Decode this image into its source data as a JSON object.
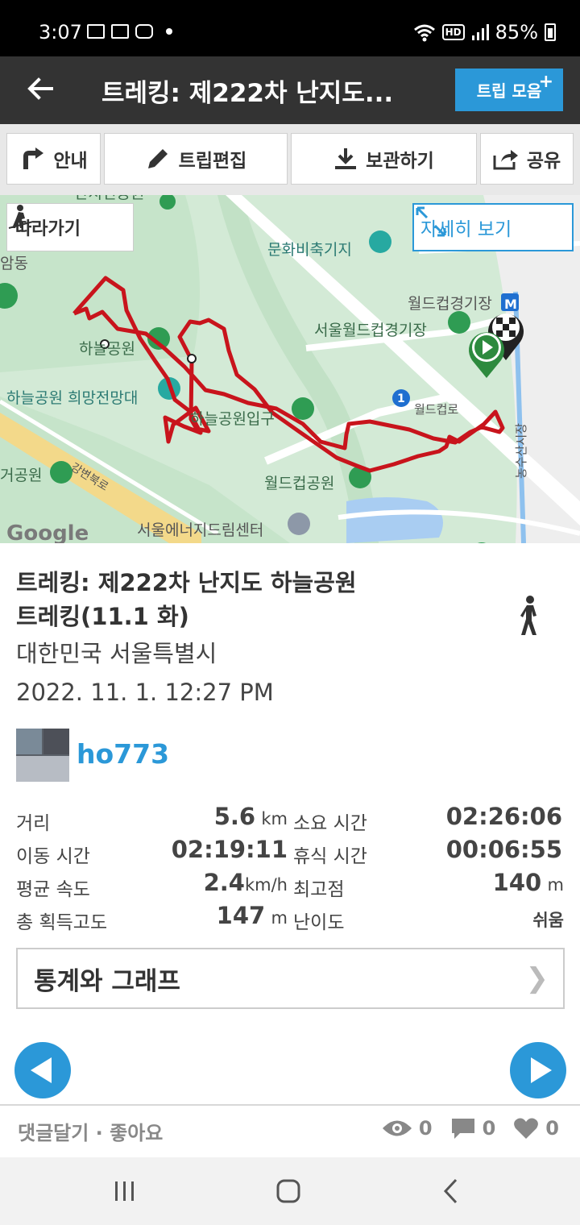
{
  "status_bar": {
    "time": "3:07",
    "battery": "85%"
  },
  "app_bar": {
    "title": "트레킹: 제222차 난지도...",
    "trip_button": "트립 모음"
  },
  "toolbar": {
    "guide": "안내",
    "edit_trip": "트립편집",
    "save": "보관하기",
    "share": "공유"
  },
  "map": {
    "follow": "따라가기",
    "view_detail": "자세히 보기",
    "labels": {
      "culture_base": "문화비축기지",
      "sky_park": "하늘공원",
      "sky_park_view": "하늘공원 희망전망대",
      "sky_park_entrance": "하늘공원입구",
      "world_cup_stadium": "월드컵경기장",
      "seoul_world_cup_stadium": "서울월드컵경기장",
      "world_cup_park": "월드컵공원",
      "world_cup_road": "월드컵로",
      "gangbyeon": "강변북로",
      "energy_dream_center": "서울에너지드림센터",
      "park_left": "거공원",
      "dong": "암동",
      "market": "농수산시장",
      "top_label": "난지연공원",
      "marker_m": "M",
      "route_no": "1",
      "google": "Google"
    }
  },
  "trip": {
    "title_line1": "트레킹: 제222차 난지도 하늘공원",
    "title_line2": "트레킹(11.1 화)",
    "location": "대한민국 서울특별시",
    "datetime": "2022. 11. 1. 12:27 PM",
    "user": "ho773"
  },
  "stats": {
    "distance_label": "거리",
    "distance_value": "5.6",
    "distance_unit": "km",
    "duration_label": "소요 시간",
    "duration_value": "02:26:06",
    "moving_label": "이동 시간",
    "moving_value": "02:19:11",
    "rest_label": "휴식 시간",
    "rest_value": "00:06:55",
    "avg_speed_label": "평균 속도",
    "avg_speed_value": "2.4",
    "avg_speed_unit": "km/h",
    "max_alt_label": "최고점",
    "max_alt_value": "140",
    "max_alt_unit": "m",
    "gain_label": "총 획득고도",
    "gain_value": "147",
    "gain_unit": "m",
    "difficulty_label": "난이도",
    "difficulty_value": "쉬움"
  },
  "graph_button": "통계와 그래프",
  "footer": {
    "comment_like": "댓글달기 · 좋아요",
    "views": "0",
    "comments": "0",
    "likes": "0"
  },
  "colors": {
    "accent": "#2b98d8",
    "route": "#c8141c",
    "map_bg": "#d3ead6"
  }
}
